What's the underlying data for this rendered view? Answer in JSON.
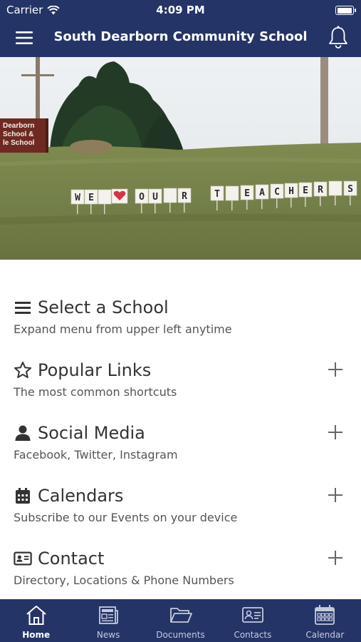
{
  "status_bar": {
    "carrier": "Carrier",
    "time": "4:09 PM"
  },
  "header": {
    "title": "South Dearborn Community School"
  },
  "hero": {
    "sign_text": [
      "Dearborn",
      "School &",
      "le School"
    ],
    "banner_left": [
      "W",
      "E",
      "O",
      "U",
      "R"
    ],
    "banner_right": [
      "T",
      "E",
      "A",
      "C",
      "H",
      "E",
      "R",
      "S"
    ]
  },
  "sections": [
    {
      "title": "Select a School",
      "subtitle": "Expand menu from upper left anytime",
      "icon": "list-icon"
    },
    {
      "title": "Popular Links",
      "subtitle": "The most common shortcuts",
      "icon": "star-icon"
    },
    {
      "title": "Social Media",
      "subtitle": "Facebook, Twitter, Instagram",
      "icon": "user-icon"
    },
    {
      "title": "Calendars",
      "subtitle": "Subscribe to our Events on your device",
      "icon": "calendar-icon"
    },
    {
      "title": "Contact",
      "subtitle": "Directory, Locations & Phone Numbers",
      "icon": "contact-card-icon"
    }
  ],
  "tabs": [
    {
      "label": "Home",
      "icon": "home-icon",
      "active": true
    },
    {
      "label": "News",
      "icon": "newspaper-icon",
      "active": false
    },
    {
      "label": "Documents",
      "icon": "folder-icon",
      "active": false
    },
    {
      "label": "Contacts",
      "icon": "contact-card-icon",
      "active": false
    },
    {
      "label": "Calendar",
      "icon": "calendar-icon",
      "active": false
    }
  ],
  "colors": {
    "brand": "#243467",
    "text": "#333333",
    "subtext": "#555555"
  }
}
